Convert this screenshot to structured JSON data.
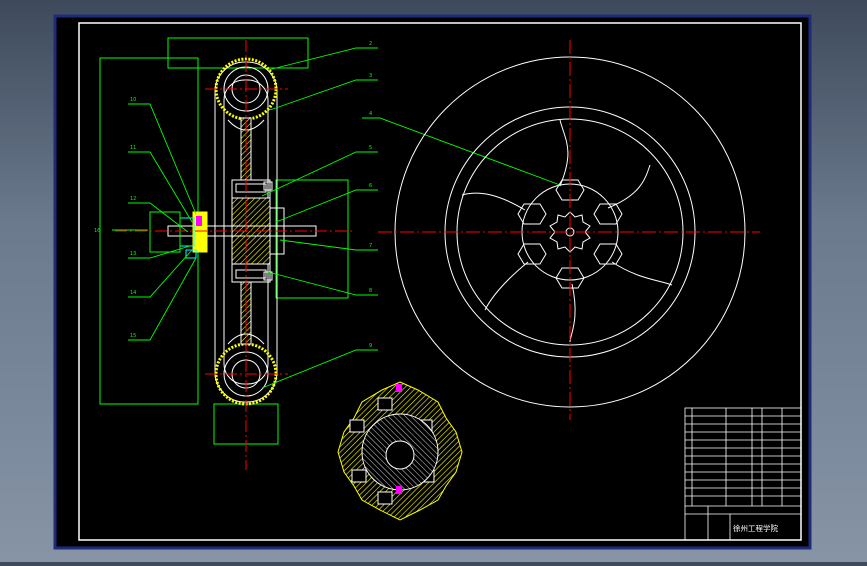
{
  "colors": {
    "background": "#000000",
    "frame": "#ffffff",
    "leader": "#00ff00",
    "part": "#ffffff",
    "hatch": "#ffff00",
    "centerline": "#ff0000",
    "dimension": "#00ff00",
    "bore": "#ff00ff"
  },
  "balloons": [
    "2",
    "3",
    "4",
    "5",
    "6",
    "7",
    "8",
    "9",
    "10",
    "11",
    "12",
    "13",
    "14",
    "15",
    "16"
  ],
  "title_block": {
    "school": "徐州工程学院"
  }
}
